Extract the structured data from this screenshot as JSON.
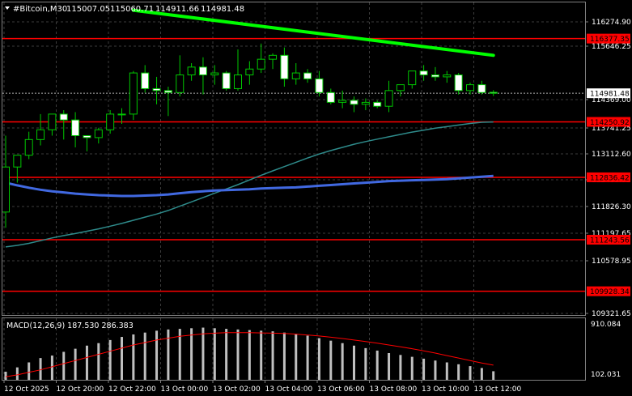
{
  "header": {
    "symbol": "#Bitcoin,M30",
    "open": "115007.05",
    "high": "115060.71",
    "low": "114911.66",
    "close": "114981.48"
  },
  "price_axis": {
    "ticks": [
      "116274.90",
      "115646.25",
      "114369.00",
      "113741.25",
      "113112.60",
      "112483.95",
      "111826.30",
      "111197.65",
      "110578.95",
      "109321.65"
    ],
    "levels": [
      {
        "label": "116377.35",
        "price": 116377.35
      },
      {
        "label": "114250.92",
        "price": 114250.92
      },
      {
        "label": "112836.42",
        "price": 112836.42
      },
      {
        "label": "111243.56",
        "price": 111243.56
      },
      {
        "label": "109928.34",
        "price": 109928.34
      }
    ],
    "current": {
      "label": "114981.48",
      "price": 114981.48
    }
  },
  "macd": {
    "label": "MACD(12,26,9) 187.530 286.383",
    "top_tick": "910.084",
    "bottom_tick": "102.031"
  },
  "time_axis": {
    "labels": [
      "12 Oct 2025",
      "12 Oct 20:00",
      "12 Oct 22:00",
      "13 Oct 00:00",
      "13 Oct 02:00",
      "13 Oct 04:00",
      "13 Oct 06:00",
      "13 Oct 08:00",
      "13 Oct 10:00",
      "13 Oct 12:00"
    ]
  },
  "colors": {
    "background": "#000000",
    "grid": "#3c3c3c",
    "bull_candle": "#000000",
    "bear_candle": "#ffffff",
    "wick": "#00c800",
    "level_line": "#ff0000",
    "level_label_bg": "#ff0000",
    "trendline": "#00ff00",
    "ma_fast": "#2e8b8b",
    "ma_slow": "#4169e1",
    "macd_hist": "#c0c0c0",
    "macd_signal": "#ff0000"
  },
  "chart_data": {
    "type": "candlestick",
    "symbol": "#Bitcoin",
    "timeframe": "M30",
    "candles": [
      {
        "o": 111950,
        "h": 113900,
        "l": 111550,
        "c": 113100
      },
      {
        "o": 113100,
        "h": 113250,
        "l": 112700,
        "c": 113400
      },
      {
        "o": 113400,
        "h": 114000,
        "l": 113300,
        "c": 113800
      },
      {
        "o": 113800,
        "h": 114450,
        "l": 113650,
        "c": 114050
      },
      {
        "o": 114050,
        "h": 114200,
        "l": 113900,
        "c": 114450
      },
      {
        "o": 114450,
        "h": 114550,
        "l": 113800,
        "c": 114300
      },
      {
        "o": 114300,
        "h": 114500,
        "l": 113600,
        "c": 113900
      },
      {
        "o": 113900,
        "h": 113850,
        "l": 113500,
        "c": 113850
      },
      {
        "o": 113850,
        "h": 114100,
        "l": 113700,
        "c": 114050
      },
      {
        "o": 114050,
        "h": 114550,
        "l": 113950,
        "c": 114450
      },
      {
        "o": 114450,
        "h": 114600,
        "l": 114200,
        "c": 114450
      },
      {
        "o": 114450,
        "h": 115550,
        "l": 114300,
        "c": 115500
      },
      {
        "o": 115500,
        "h": 115700,
        "l": 115000,
        "c": 115100
      },
      {
        "o": 115100,
        "h": 115400,
        "l": 114700,
        "c": 115050
      },
      {
        "o": 115050,
        "h": 115150,
        "l": 114400,
        "c": 115000
      },
      {
        "o": 115000,
        "h": 115950,
        "l": 114900,
        "c": 115450
      },
      {
        "o": 115450,
        "h": 115750,
        "l": 115300,
        "c": 115650
      },
      {
        "o": 115650,
        "h": 115900,
        "l": 114950,
        "c": 115450
      },
      {
        "o": 115450,
        "h": 115700,
        "l": 115200,
        "c": 115500
      },
      {
        "o": 115500,
        "h": 115550,
        "l": 115050,
        "c": 115100
      },
      {
        "o": 115100,
        "h": 116100,
        "l": 115050,
        "c": 115450
      },
      {
        "o": 115450,
        "h": 115800,
        "l": 115200,
        "c": 115600
      },
      {
        "o": 115600,
        "h": 116250,
        "l": 115500,
        "c": 115850
      },
      {
        "o": 115850,
        "h": 116000,
        "l": 115600,
        "c": 115950
      },
      {
        "o": 115950,
        "h": 116150,
        "l": 115150,
        "c": 115350
      },
      {
        "o": 115350,
        "h": 115750,
        "l": 115200,
        "c": 115500
      },
      {
        "o": 115500,
        "h": 115600,
        "l": 115250,
        "c": 115350
      },
      {
        "o": 115350,
        "h": 115550,
        "l": 114900,
        "c": 115000
      },
      {
        "o": 115000,
        "h": 115100,
        "l": 114700,
        "c": 114750
      },
      {
        "o": 114750,
        "h": 115050,
        "l": 114600,
        "c": 114800
      },
      {
        "o": 114800,
        "h": 114900,
        "l": 114500,
        "c": 114700
      },
      {
        "o": 114700,
        "h": 114850,
        "l": 114550,
        "c": 114750
      },
      {
        "o": 114750,
        "h": 114800,
        "l": 114600,
        "c": 114650
      },
      {
        "o": 114650,
        "h": 115300,
        "l": 114500,
        "c": 115050
      },
      {
        "o": 115050,
        "h": 115200,
        "l": 114900,
        "c": 115200
      },
      {
        "o": 115200,
        "h": 115550,
        "l": 115100,
        "c": 115550
      },
      {
        "o": 115550,
        "h": 115700,
        "l": 115300,
        "c": 115450
      },
      {
        "o": 115450,
        "h": 115650,
        "l": 115300,
        "c": 115400
      },
      {
        "o": 115400,
        "h": 115550,
        "l": 115250,
        "c": 115450
      },
      {
        "o": 115450,
        "h": 115500,
        "l": 114950,
        "c": 115050
      },
      {
        "o": 115050,
        "h": 115250,
        "l": 114950,
        "c": 115200
      },
      {
        "o": 115200,
        "h": 115300,
        "l": 114950,
        "c": 115000
      },
      {
        "o": 115007.05,
        "h": 115060.71,
        "l": 114911.66,
        "c": 114981.48
      }
    ],
    "horizontal_levels": [
      116377.35,
      114250.92,
      112836.42,
      111243.56,
      109928.34
    ],
    "trendline": [
      {
        "bar": 11,
        "price": 117100
      },
      {
        "bar": 42,
        "price": 115950
      }
    ],
    "ma_fast": [
      111060,
      111100,
      111150,
      111220,
      111290,
      111350,
      111400,
      111460,
      111520,
      111590,
      111660,
      111740,
      111820,
      111900,
      111990,
      112100,
      112210,
      112320,
      112430,
      112540,
      112650,
      112770,
      112890,
      113000,
      113110,
      113220,
      113330,
      113430,
      113520,
      113600,
      113680,
      113750,
      113810,
      113870,
      113930,
      113990,
      114040,
      114090,
      114130,
      114170,
      114210,
      114240,
      114250
    ],
    "ma_slow": [
      112700,
      112630,
      112570,
      112520,
      112480,
      112450,
      112420,
      112400,
      112380,
      112370,
      112360,
      112360,
      112370,
      112380,
      112400,
      112430,
      112460,
      112480,
      112500,
      112510,
      112520,
      112530,
      112550,
      112560,
      112570,
      112580,
      112600,
      112620,
      112640,
      112660,
      112680,
      112700,
      112720,
      112740,
      112750,
      112760,
      112770,
      112780,
      112790,
      112810,
      112830,
      112850,
      112870
    ],
    "macd_hist": [
      180,
      250,
      330,
      400,
      440,
      500,
      550,
      600,
      640,
      690,
      740,
      780,
      810,
      840,
      860,
      870,
      880,
      890,
      880,
      870,
      860,
      850,
      840,
      830,
      810,
      790,
      760,
      720,
      680,
      640,
      600,
      560,
      520,
      480,
      450,
      420,
      390,
      360,
      330,
      300,
      270,
      240,
      187.53
    ],
    "macd_signal": [
      100,
      130,
      170,
      210,
      260,
      310,
      360,
      410,
      460,
      510,
      560,
      610,
      650,
      690,
      720,
      750,
      770,
      790,
      800,
      810,
      810,
      810,
      805,
      800,
      795,
      785,
      770,
      755,
      735,
      715,
      690,
      665,
      640,
      610,
      580,
      550,
      515,
      480,
      440,
      400,
      360,
      320,
      286.383
    ],
    "price_range": [
      109321.65,
      117300
    ],
    "macd_range": [
      102.031,
      910.084
    ]
  }
}
